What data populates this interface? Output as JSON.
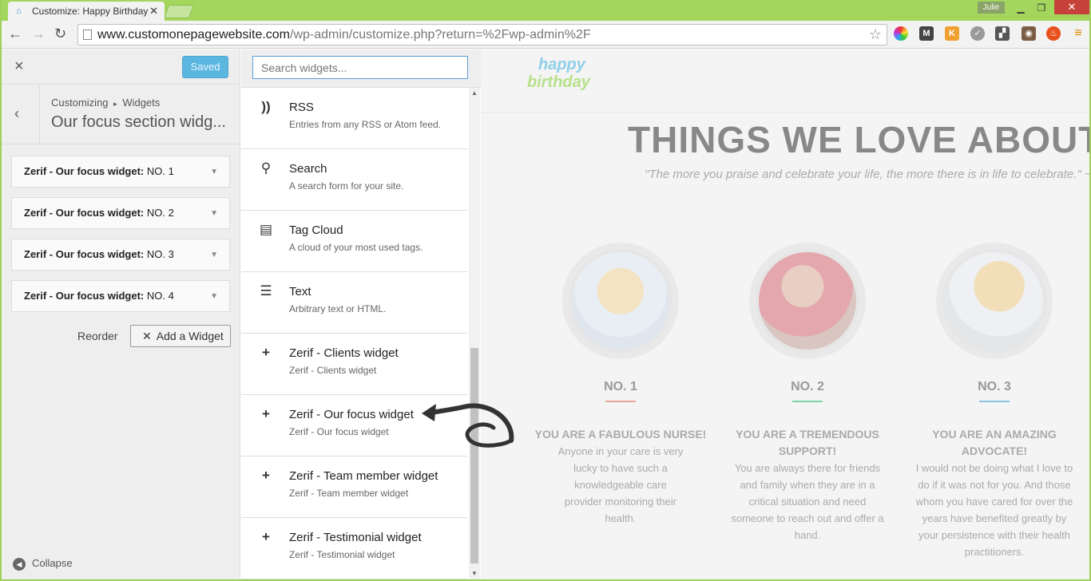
{
  "browser": {
    "tab_title": "Customize: Happy Birthday",
    "user_badge": "Julie",
    "url_host": "www.customonepagewebsite.com",
    "url_path": "/wp-admin/customize.php?return=%2Fwp-admin%2F",
    "window_buttons": {
      "minimize": "▁",
      "maximize": "❐",
      "close": "✕"
    }
  },
  "panel": {
    "saved_label": "Saved",
    "close_label": "×",
    "back_label": "‹",
    "breadcrumb_parent": "Customizing",
    "breadcrumb_sep": "▸",
    "breadcrumb_child": "Widgets",
    "section_title": "Our focus section widg...",
    "widgets": [
      {
        "name": "Zerif - Our focus widget:",
        "suffix": "NO. 1"
      },
      {
        "name": "Zerif - Our focus widget:",
        "suffix": "NO. 2"
      },
      {
        "name": "Zerif - Our focus widget:",
        "suffix": "NO. 3"
      },
      {
        "name": "Zerif - Our focus widget:",
        "suffix": "NO. 4"
      }
    ],
    "reorder_label": "Reorder",
    "add_widget_label": "Add a Widget",
    "collapse_label": "Collapse"
  },
  "widget_list": {
    "search_placeholder": "Search widgets...",
    "items": [
      {
        "icon": "rss-icon",
        "glyph": "))",
        "title": "RSS",
        "desc": "Entries from any RSS or Atom feed."
      },
      {
        "icon": "search-icon",
        "glyph": "⚲",
        "title": "Search",
        "desc": "A search form for your site."
      },
      {
        "icon": "tag-cloud-icon",
        "glyph": "▤",
        "title": "Tag Cloud",
        "desc": "A cloud of your most used tags."
      },
      {
        "icon": "text-icon",
        "glyph": "☰",
        "title": "Text",
        "desc": "Arbitrary text or HTML."
      },
      {
        "icon": "plus-icon",
        "glyph": "+",
        "title": "Zerif - Clients widget",
        "desc": "Zerif - Clients widget"
      },
      {
        "icon": "plus-icon",
        "glyph": "+",
        "title": "Zerif - Our focus widget",
        "desc": "Zerif - Our focus widget"
      },
      {
        "icon": "plus-icon",
        "glyph": "+",
        "title": "Zerif - Team member widget",
        "desc": "Zerif - Team member widget"
      },
      {
        "icon": "plus-icon",
        "glyph": "+",
        "title": "Zerif - Testimonial widget",
        "desc": "Zerif - Testimonial widget"
      }
    ]
  },
  "preview": {
    "logo_line1": "happy",
    "logo_line2": "birthday",
    "heading": "THINGS WE LOVE ABOUT",
    "quote": "\"The more you praise and celebrate your life, the more there is in life to celebrate.\" ~ Op",
    "members": [
      {
        "num": "NO. 1",
        "title": "YOU ARE A FABULOUS NURSE!",
        "text": "Anyone in your care is very lucky to have such a knowledgeable care provider monitoring their health.",
        "accent": "#e8a496"
      },
      {
        "num": "NO. 2",
        "title": "YOU ARE A TREMENDOUS SUPPORT!",
        "text": "You are always there for friends and family when they are in a critical situation and need someone to reach out and offer a hand.",
        "accent": "#7ed3a8"
      },
      {
        "num": "NO. 3",
        "title": "YOU ARE AN AMAZING ADVOCATE!",
        "text": "I would not be doing what I love to do if it was not for you. And those whom you have cared for over the years have benefited greatly by your persistence with their health practitioners.",
        "accent": "#8cc4e6"
      }
    ]
  }
}
